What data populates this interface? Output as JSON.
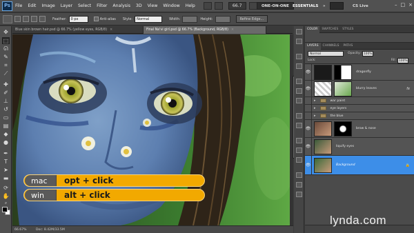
{
  "menubar": {
    "app_logo": "Ps",
    "items": [
      "File",
      "Edit",
      "Image",
      "Layer",
      "Select",
      "Filter",
      "Analysis",
      "3D",
      "View",
      "Window",
      "Help"
    ],
    "zoom": "66.7"
  },
  "workspace": {
    "one_on_one": "ONE-ON-ONE",
    "essentials": "ESSENTIALS",
    "more": "»",
    "cs_live": "CS Live"
  },
  "window_controls": [
    "–",
    "□",
    "×"
  ],
  "options": {
    "feather_label": "Feather:",
    "feather_value": "0 px",
    "antialias_label": "Anti-alias",
    "style_label": "Style:",
    "style_value": "Normal",
    "width_label": "Width:",
    "height_label": "Height:",
    "refine_edge": "Refine Edge..."
  },
  "tabs": [
    "Blue skin brown hair.psd @ 66.7% (yellow eyes, RGB/8)",
    "Final Na'vi girl.psd @ 66.7% (Background, RGB/8)"
  ],
  "status": {
    "zoom": "66.67%",
    "doc": "Doc: 8.42M/33.5M"
  },
  "shortcuts": [
    {
      "os": "mac",
      "keys": "opt + click"
    },
    {
      "os": "win",
      "keys": "alt + click"
    }
  ],
  "panels": {
    "top_tabs": [
      "COLOR",
      "SWATCHES",
      "STYLES"
    ],
    "layer_tabs": [
      "LAYERS",
      "CHANNELS",
      "PATHS"
    ],
    "blend_mode": "Normal",
    "opacity_label": "Opacity:",
    "opacity_value": "100%",
    "lock_label": "Lock:",
    "fill_label": "Fill:",
    "fill_value": "100%",
    "layers": [
      {
        "name": "dragonfly",
        "type": "masked"
      },
      {
        "name": "blurry leaves",
        "type": "fx",
        "fx": "fx"
      },
      {
        "name": "war paint",
        "type": "group"
      },
      {
        "name": "eye layers",
        "type": "group"
      },
      {
        "name": "the blue",
        "type": "group"
      },
      {
        "name": "brow & nose",
        "type": "masked"
      },
      {
        "name": "liquify eyes",
        "type": "pixel"
      },
      {
        "name": "Background",
        "type": "background",
        "selected": true
      }
    ]
  },
  "watermark": "lynda.com"
}
